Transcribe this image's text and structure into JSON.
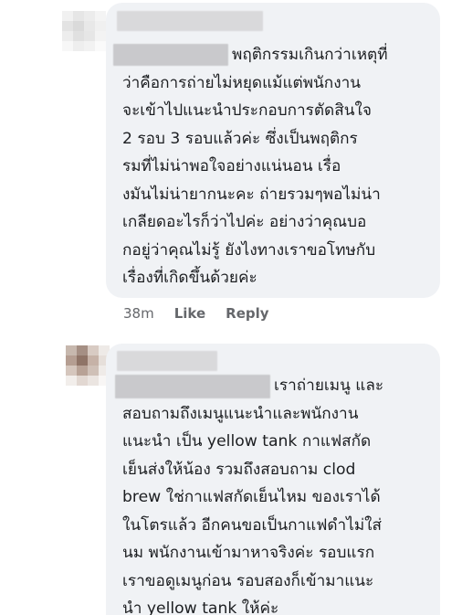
{
  "comments": [
    {
      "text": "พฤติกรรมเกินกว่าเหตุที่\nว่าคือการถ่ายไม่หยุดแม้แต่พนักงาน\nจะเข้าไปแนะนำประกอบการตัดสินใจ\n2 รอบ 3 รอบแล้วค่ะ ซึ่งเป็นพฤติกร\nรมที่ไม่น่าพอใจอย่างแน่นอน เรื่อ\nงมันไม่น่ายากนะคะ ถ่ายรวมๆพอไม่น่า\nเกลียดอะไรก็ว่าไปค่ะ อย่างว่าคุณบอ\nกอยู่ว่าคุณไม่รู้ ยังไงทางเราขอโทษกับ\nเรื่องที่เกิดขึ้นด้วยค่ะ",
      "time": "38m",
      "like_label": "Like",
      "reply_label": "Reply"
    },
    {
      "text": "เราถ่ายเมนู และ\nสอบถามถึงเมนูแนะนำและพนักงาน\nแนะนำ เป็น yellow tank กาแฟสกัด\nเย็นส่งให้น้อง รวมถึงสอบถาม clod\nbrew ใช่กาแฟสกัดเย็นไหม ของเราได้\nในโตรแล้ว อีกคนขอเป็นกาแฟดำไม่ใส่\nนม พนักงานเข้ามาหาจริงค่ะ รอบแรก\nเราขอดูเมนูก่อน รอบสองก็เข้ามาแนะ\nนำ yellow tank ให้ค่ะ"
    }
  ]
}
